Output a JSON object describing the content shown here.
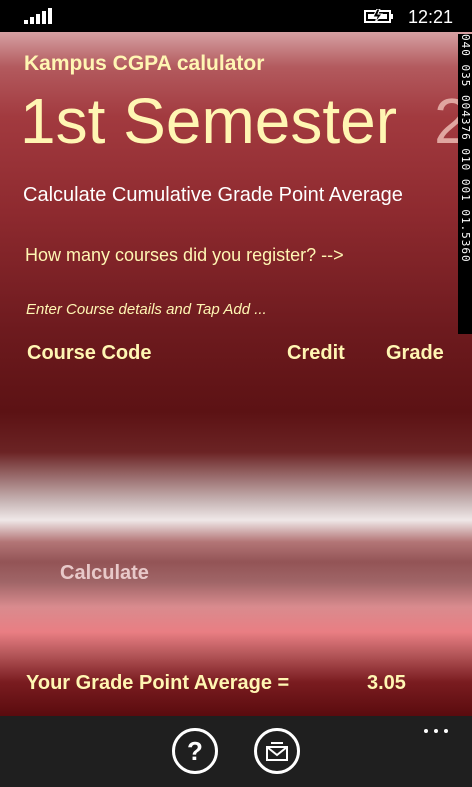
{
  "status_bar": {
    "time": "12:21",
    "signal_icon": "signal-strength-icon",
    "battery_icon": "battery-charging-icon"
  },
  "app": {
    "title": "Kampus CGPA calulator",
    "pivot": {
      "current": "1st Semester",
      "next_peek": "2"
    },
    "subtitle": "Calculate Cumulative Grade Point Average",
    "course_count_prompt": "How many courses did you register? -->",
    "hint": "Enter Course details and Tap Add ...",
    "columns": {
      "course_code": "Course  Code",
      "credit": "Credit",
      "grade": "Grade"
    },
    "calculate_label": "Calculate",
    "gpa_label": "Your Grade Point Average =",
    "gpa_value": "3.05"
  },
  "debug_counter": "040 035 004376 010 001 01.5360",
  "app_bar": {
    "help_icon": "help-icon",
    "help_glyph": "?",
    "mail_icon": "mail-icon",
    "more_icon": "more-icon"
  },
  "colors": {
    "accent_text": "#fff6b3",
    "background_dark": "#5c1214",
    "app_bar": "#1f1f1f"
  }
}
